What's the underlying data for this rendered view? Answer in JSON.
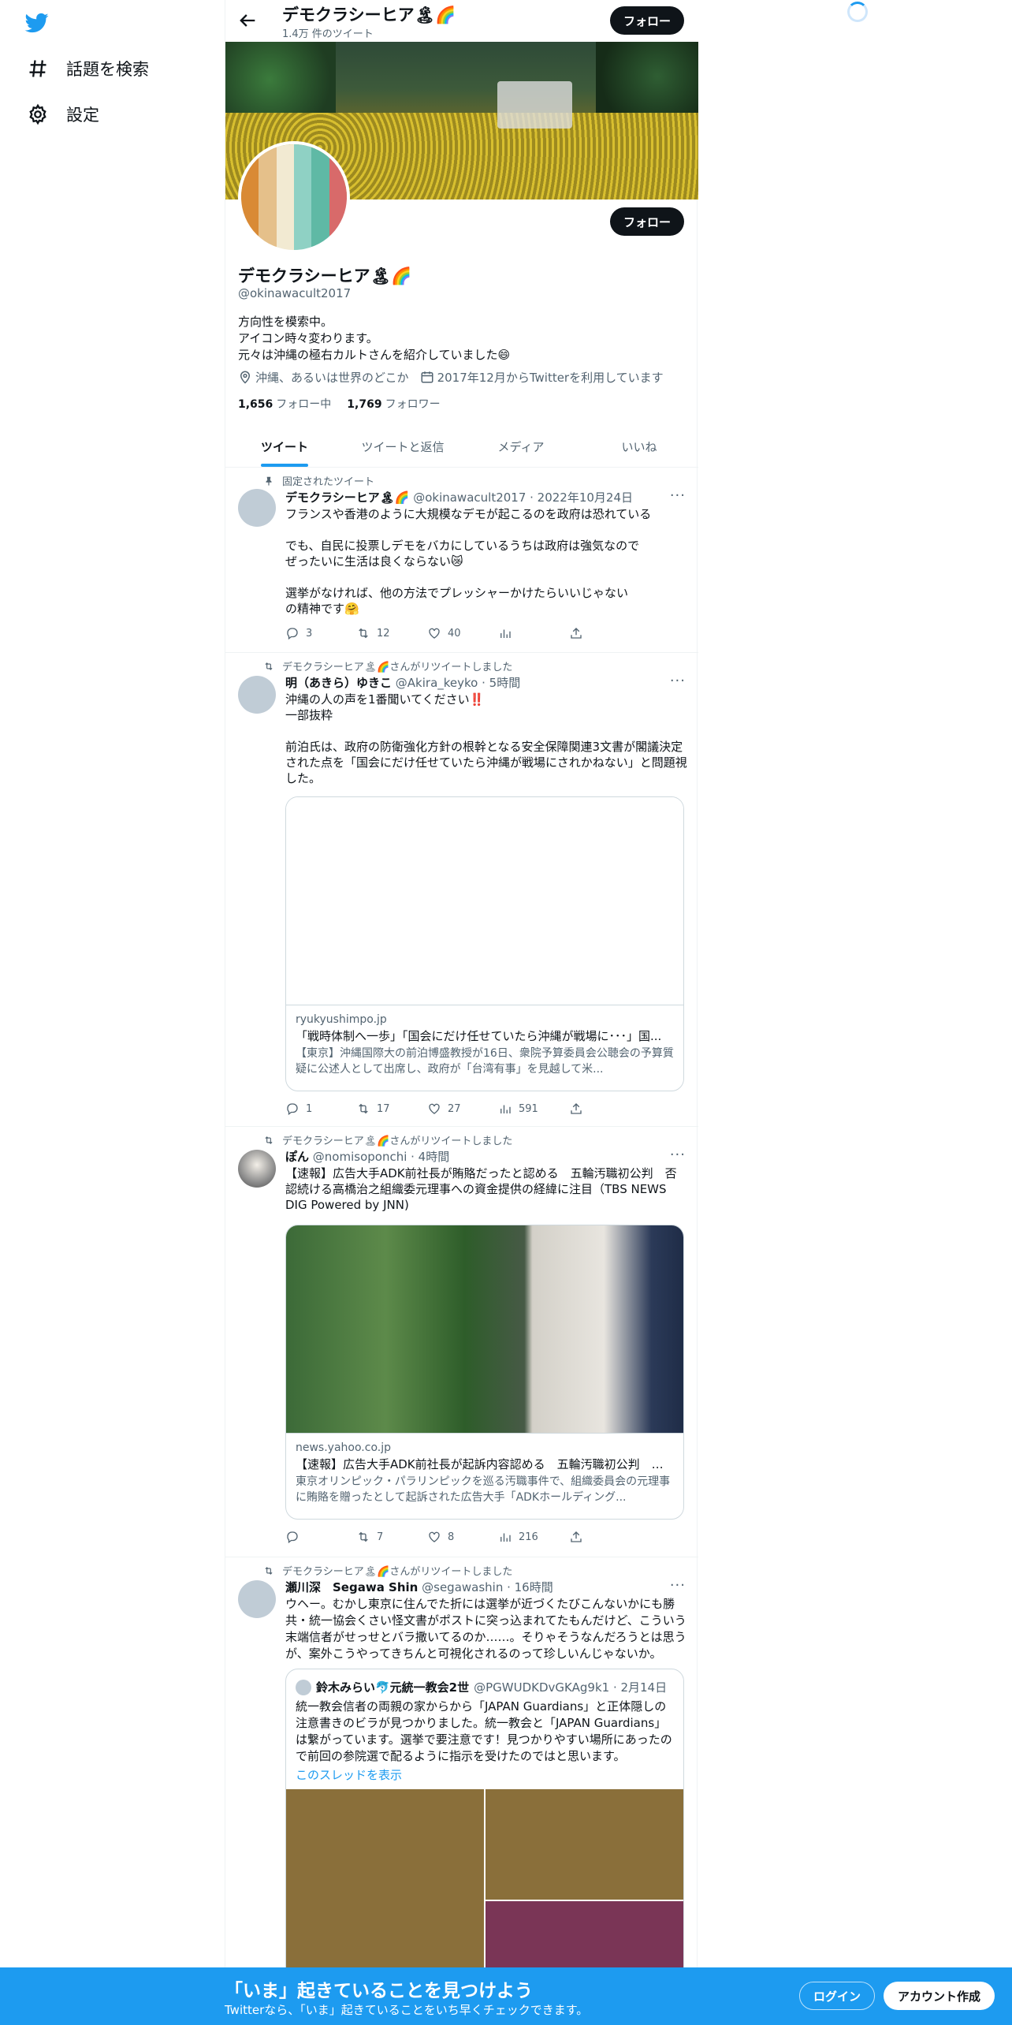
{
  "sidebar": {
    "logo": "twitter-bird-icon",
    "items": [
      {
        "label": "話題を検索",
        "icon": "hashtag-icon"
      },
      {
        "label": "設定",
        "icon": "gear-icon"
      }
    ]
  },
  "header": {
    "title": "デモクラシーヒア🏝🌈",
    "subtitle": "1.4万 件のツイート",
    "follow_label": "フォロー"
  },
  "profile": {
    "name": "デモクラシーヒア🏝🌈",
    "handle": "@okinawacult2017",
    "follow_label": "フォロー",
    "bio": "方向性を模索中。\nアイコン時々変わります。\n元々は沖縄の極右カルトさんを紹介していました😄",
    "location": "沖縄、あるいは世界のどこか",
    "joined": "2017年12月からTwitterを利用しています",
    "following_count": "1,656",
    "following_label": "フォロー中",
    "followers_count": "1,769",
    "followers_label": "フォロワー",
    "avatar_colors": [
      "#d98a35",
      "#e5c08a",
      "#f2ead2",
      "#8fd1c4",
      "#5fb9a5",
      "#d86a6a"
    ]
  },
  "tabs": [
    "ツイート",
    "ツイートと返信",
    "メディア",
    "いいね"
  ],
  "tweets": [
    {
      "context": "固定されたツイート",
      "name": "デモクラシーヒア🏝🌈",
      "meta": "@okinawacult2017 · 2022年10月24日",
      "text": "フランスや香港のように大規模なデモが起こるのを政府は恐れている\n\nでも、自民に投票しデモをバカにしているうちは政府は強気なので\nぜったいに生活は良くならない😿\n\n選挙がなければ、他の方法でプレッシャーかけたらいいじゃない\nの精神です🤗",
      "replies": "3",
      "retweets": "12",
      "likes": "40",
      "views": ""
    },
    {
      "context": "デモクラシーヒア🏝🌈さんがリツイートしました",
      "name": "明（あきら）ゆきこ",
      "meta": "@Akira_keyko · 5時間",
      "text": "沖縄の人の声を1番聞いてください‼️\n一部抜粋\n\n前泊氏は、政府の防衛強化方針の根幹となる安全保障関連3文書が閣議決定された点を「国会にだけ任せていたら沖縄が戦場にされかねない」と問題視した。",
      "card": {
        "domain": "ryukyushimpo.jp",
        "title": "「戦時体制へ一歩」「国会にだけ任せていたら沖縄が戦場に･･･」国...",
        "desc": "【東京】沖縄国際大の前泊博盛教授が16日、衆院予算委員会公聴会の予算質疑に公述人として出席し、政府が「台湾有事」を見越して米..."
      },
      "replies": "1",
      "retweets": "17",
      "likes": "27",
      "views": "591"
    },
    {
      "context": "デモクラシーヒア🏝🌈さんがリツイートしました",
      "name": "ぽん",
      "meta": "@nomisoponchi · 4時間",
      "text": "【速報】広告大手ADK前社長が賄賂だったと認める　五輪汚職初公判　否認続ける高橋治之組織委元理事への資金提供の経緯に注目（TBS NEWS DIG Powered by JNN)",
      "card": {
        "domain": "news.yahoo.co.jp",
        "title": "【速報】広告大手ADK前社長が起訴内容認める　五輪汚職初公判　否...",
        "desc": "東京オリンピック・パラリンピックを巡る汚職事件で、組織委員会の元理事に賄賂を贈ったとして起訴された広告大手「ADKホールディング..."
      },
      "replies": "",
      "retweets": "7",
      "likes": "8",
      "views": "216"
    },
    {
      "context": "デモクラシーヒア🏝🌈さんがリツイートしました",
      "name": "瀬川深　Segawa Shin",
      "meta": "@segawashin · 16時間",
      "text": "ウヘー。むかし東京に住んでた折には選挙が近づくたびこんないかにも勝共・統一協会くさい怪文書がポストに突っ込まれてたもんだけど、こういう末端信者がせっせとバラ撒いてるのか……。そりゃそうなんだろうとは思うが、案外こうやってきちんと可視化されるのって珍しいんじゃないか。",
      "quote": {
        "name": "鈴木みらい🐬元統一教会2世",
        "meta": "@PGWUDKDvGKAg9k1 · 2月14日",
        "text": "統一教会信者の両親の家からから「JAPAN Guardians」と正体隠しの注意書きのビラが見つかりました。統一教会と「JAPAN Guardians」は繋がっています。選挙で要注意です！見つかりやすい場所にあったので前回の参院選で配るように指示を受けたのではと思います。",
        "link": "このスレッドを表示"
      }
    }
  ],
  "bottom_bar": {
    "title": "「いま」起きていることを見つけよう",
    "subtitle": "Twitterなら、「いま」起きていることをいち早くチェックできます。",
    "login_label": "ログイン",
    "signup_label": "アカウント作成"
  },
  "colors": {
    "accent": "#1d9bf0",
    "text": "#0f1419",
    "muted": "#536471"
  }
}
